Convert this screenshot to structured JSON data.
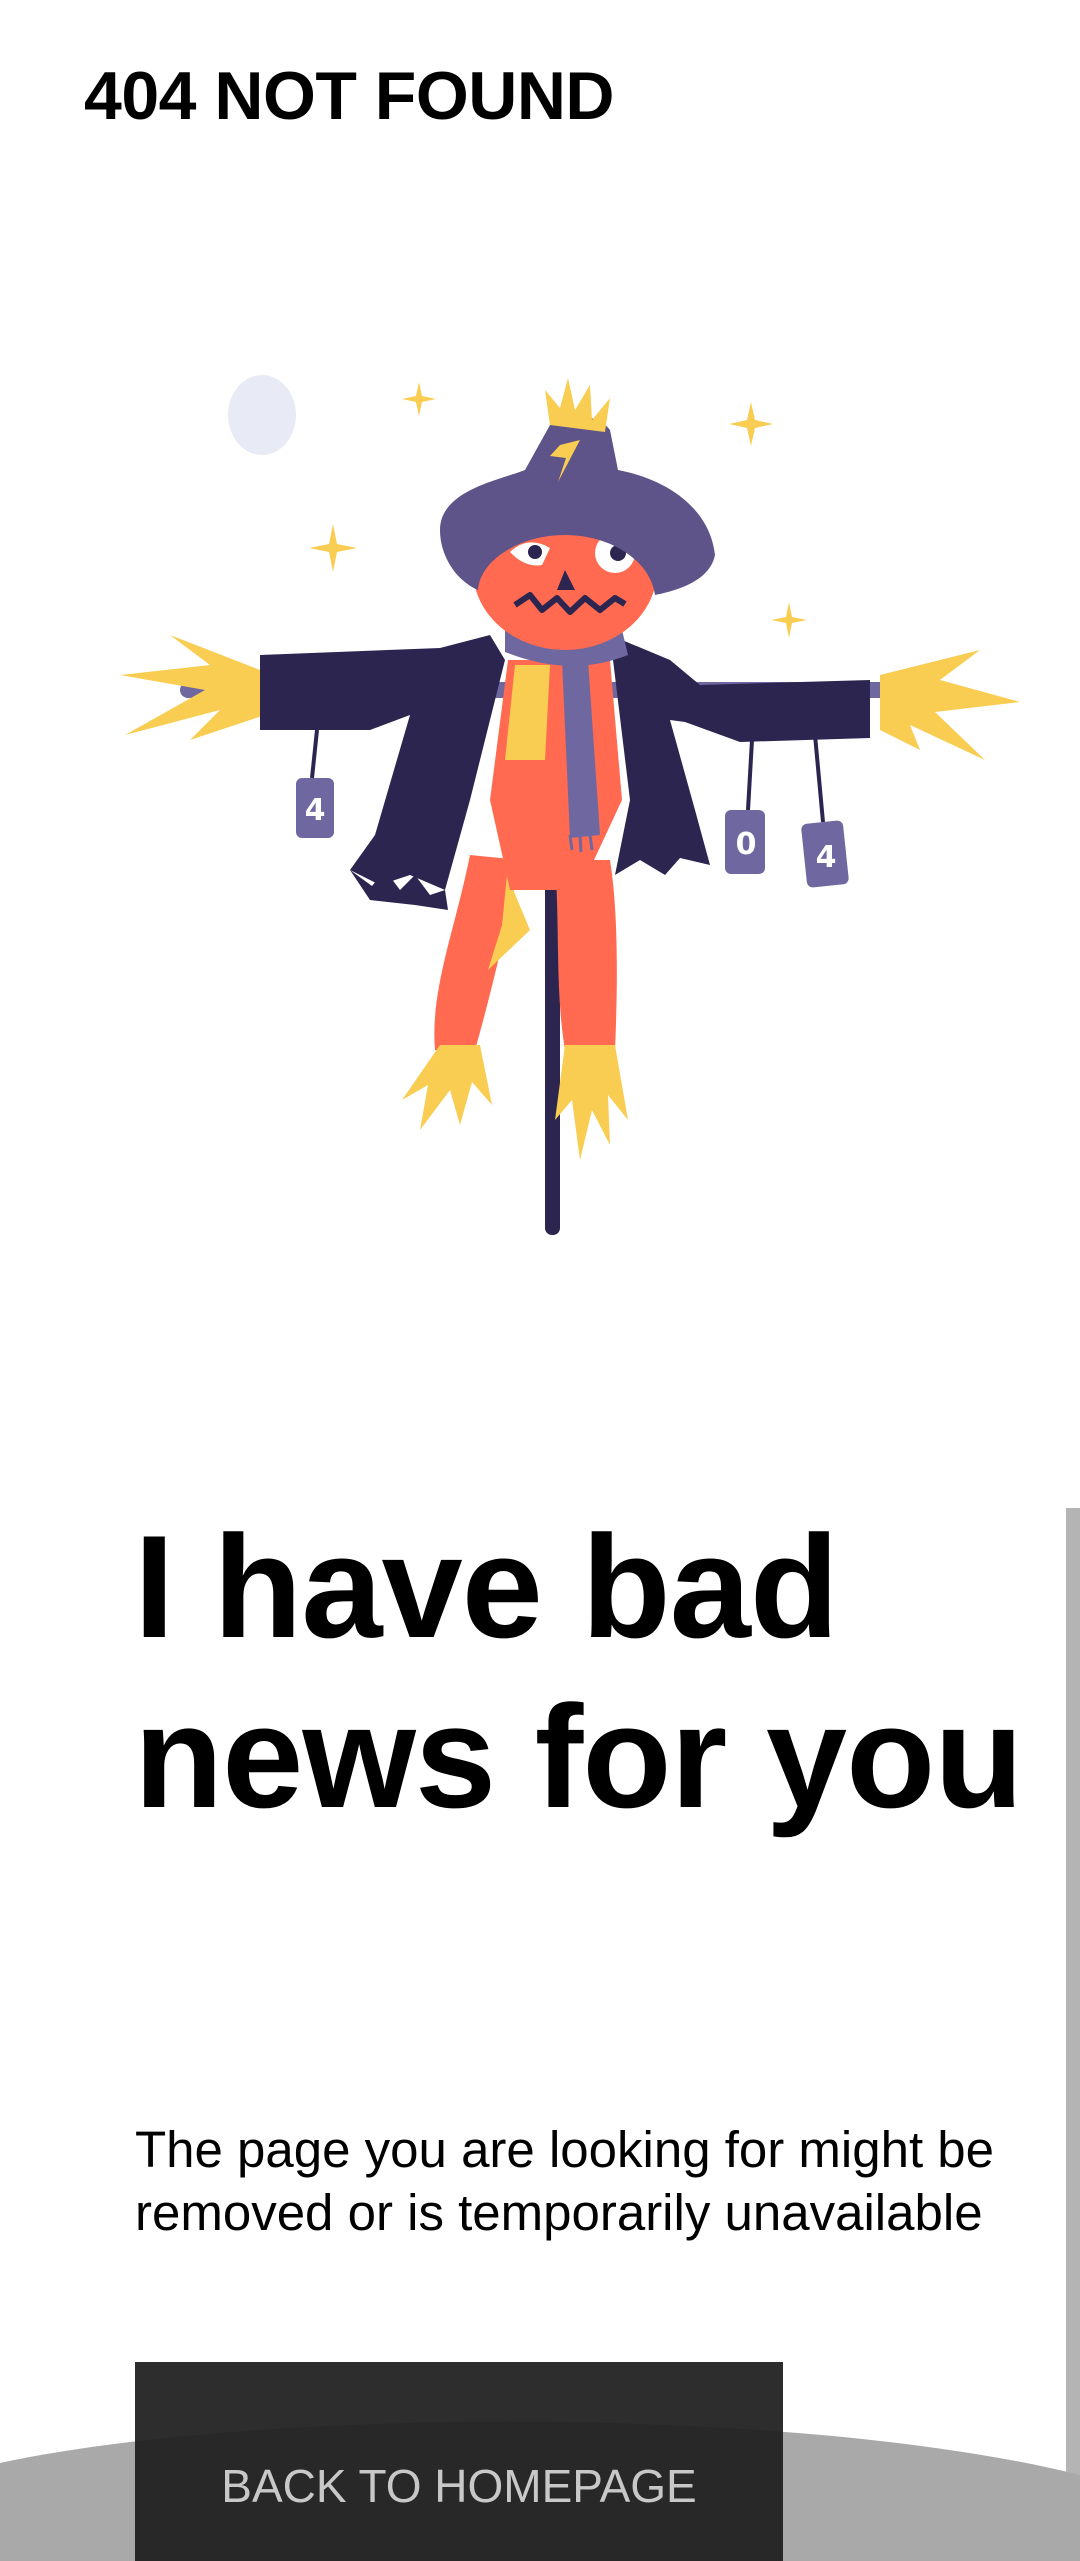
{
  "header": {
    "title": "404 NOT FOUND"
  },
  "illustration": {
    "subject": "scarecrow",
    "cans": [
      "4",
      "0",
      "4"
    ]
  },
  "content": {
    "headline": "I have bad news for you",
    "message": "The page you are looking for might be removed or is temporarily unavailable",
    "cta_label": "BACK TO HOMEPAGE"
  },
  "colors": {
    "coat": "#2c2550",
    "hat": "#5e5489",
    "scarf": "#6e67a0",
    "pumpkin": "#ff6a50",
    "straw": "#f9cd52",
    "moon": "#e8ebf5",
    "button_bg": "#202020",
    "button_text": "#c8c8c8"
  }
}
